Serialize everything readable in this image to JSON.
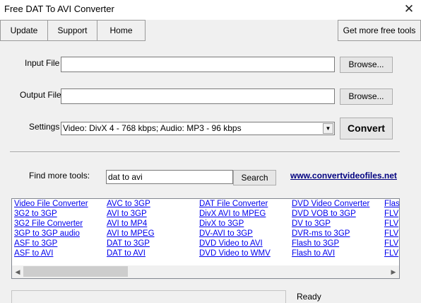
{
  "window": {
    "title": "Free DAT To AVI Converter",
    "close_glyph": "✕"
  },
  "toolbar": {
    "update": "Update",
    "support": "Support",
    "home": "Home",
    "more_tools": "Get more free tools"
  },
  "form": {
    "input_label": "Input File",
    "input_value": "",
    "output_label": "Output File",
    "output_value": "",
    "browse": "Browse...",
    "settings_label": "Settings",
    "settings_value": "Video: DivX 4 - 768 kbps; Audio: MP3 - 96 kbps",
    "convert": "Convert"
  },
  "find": {
    "label": "Find more tools:",
    "search_value": "dat to avi",
    "search_button": "Search",
    "site_link": "www.convertvideofiles.net"
  },
  "tools": {
    "col1": [
      "Video File Converter",
      "3G2 to 3GP",
      "3G2 File Converter",
      "3GP to 3GP audio",
      "ASF to 3GP",
      "ASF to AVI"
    ],
    "col2": [
      "AVC to 3GP",
      "AVI to 3GP",
      "AVI to MP4",
      "AVI to MPEG",
      "DAT to 3GP",
      "DAT to AVI"
    ],
    "col3": [
      "DAT File Converter",
      "DivX AVI to MPEG",
      "DivX to 3GP",
      "DV-AVI to 3GP",
      "DVD Video to AVI",
      "DVD Video to WMV"
    ],
    "col4": [
      "DVD Video Converter",
      "DVD VOB to 3GP",
      "DV to 3GP",
      "DVR-ms to 3GP",
      "Flash to 3GP",
      "Flash to AVI"
    ],
    "col5": [
      "Flash",
      "FLV",
      "FLV",
      "FLV",
      "FLV",
      "FLV"
    ]
  },
  "status": {
    "text": "Ready",
    "progress": 0
  },
  "icons": [
    "close-icon",
    "dropdown-arrow-icon",
    "scroll-left-icon",
    "scroll-right-icon"
  ]
}
